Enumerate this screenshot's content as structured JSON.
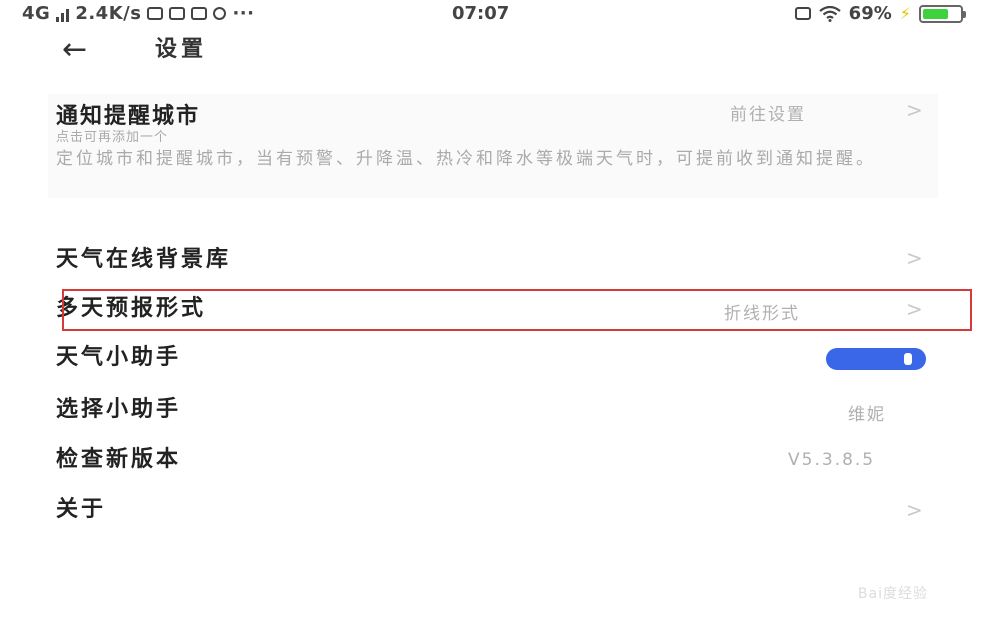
{
  "status_bar": {
    "network": "4G",
    "speed": "2.4K/s",
    "extra": "···",
    "time": "07:07",
    "battery_text": "69%",
    "battery_level": 0.69,
    "battery_color": "#3ed23e"
  },
  "header": {
    "back_icon": "←",
    "title": "设置"
  },
  "notify": {
    "title": "通知提醒城市",
    "subtitle": "点击可再添加一个",
    "value": "前往设置",
    "chevron": ">",
    "description": "定位城市和提醒城市，当有预警、升降温、热冷和降水等极端天气时，可提前收到通知提醒。"
  },
  "rows": [
    {
      "label": "天气在线背景库",
      "value": "",
      "chevron": ">"
    },
    {
      "label": "多天预报形式",
      "value": "折线形式",
      "chevron": ">"
    },
    {
      "label": "天气小助手",
      "toggle_on": true
    },
    {
      "label": "选择小助手",
      "value": "维妮"
    },
    {
      "label": "检查新版本",
      "value": "V5.3.8.5"
    },
    {
      "label": "关于",
      "value": "",
      "chevron": ">"
    }
  ],
  "colors": {
    "toggle_on": "#3a66e8",
    "highlight": "#d83a3a"
  },
  "watermark": "Bai度经验"
}
